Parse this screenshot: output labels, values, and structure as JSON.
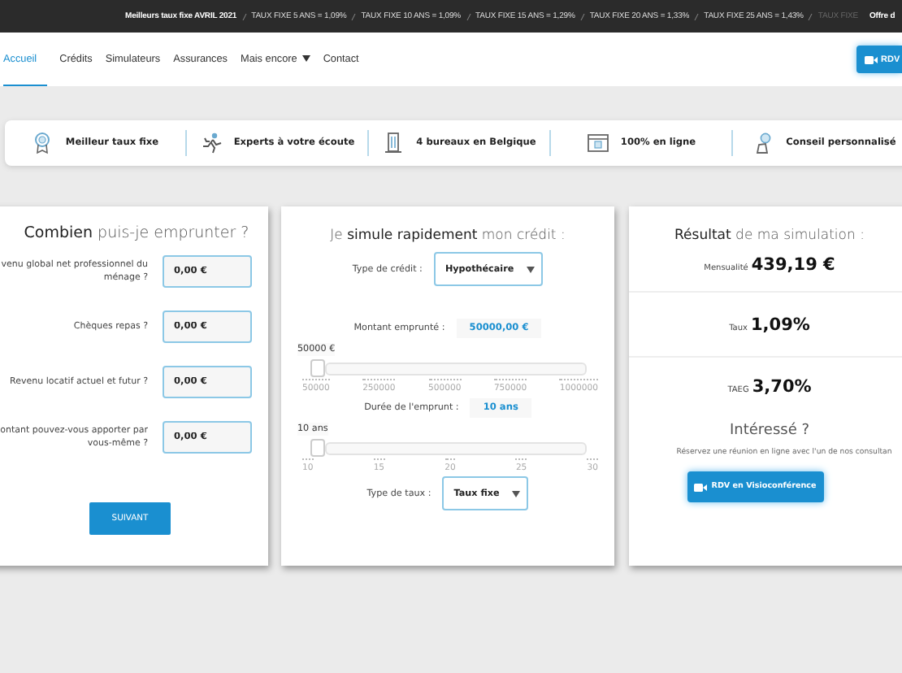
{
  "ticker": {
    "items": [
      {
        "text": "Meilleurs taux fixe AVRIL 2021",
        "kind": "heading"
      },
      {
        "text": "TAUX FIXE 5 ANS = 1,09%",
        "kind": "rate"
      },
      {
        "text": "TAUX FIXE 10 ANS = 1,09%",
        "kind": "rate"
      },
      {
        "text": "TAUX FIXE 15 ANS = 1,29%",
        "kind": "rate"
      },
      {
        "text": "TAUX FIXE 20 ANS = 1,33%",
        "kind": "rate"
      },
      {
        "text": "TAUX FIXE 25 ANS = 1,43%",
        "kind": "rate"
      },
      {
        "text": "TAUX FIXE",
        "kind": "faded"
      },
      {
        "text": "Offre d",
        "kind": "offer"
      }
    ]
  },
  "nav": {
    "items": [
      {
        "label": "Accueil",
        "selected": true,
        "dropdown": false
      },
      {
        "label": "Crédits",
        "selected": false,
        "dropdown": false
      },
      {
        "label": "Simulateurs",
        "selected": false,
        "dropdown": false
      },
      {
        "label": "Assurances",
        "selected": false,
        "dropdown": false
      },
      {
        "label": "Mais encore",
        "selected": false,
        "dropdown": true
      },
      {
        "label": "Contact",
        "selected": false,
        "dropdown": false
      }
    ],
    "button": {
      "label": "RDV"
    }
  },
  "features": [
    {
      "label": "Meilleur taux fixe"
    },
    {
      "label": "Experts à votre écoute"
    },
    {
      "label": "4 bureaux en Belgique"
    },
    {
      "label": "100% en ligne"
    },
    {
      "label": "Conseil personnalisé"
    }
  ],
  "borrow_card": {
    "title": "**Combien** puis-je emprunter ?",
    "fields": [
      {
        "label": "venu global net professionnel du ménage ?",
        "value": "0,00 €"
      },
      {
        "label": "Chèques repas ?",
        "value": "0,00 €"
      },
      {
        "label": "Revenu locatif actuel et futur ?",
        "value": "0,00 €"
      },
      {
        "label": "ontant pouvez-vous apporter par vous-même ?",
        "value": "0,00 €"
      }
    ],
    "button": "SUIVANT"
  },
  "simulate_card": {
    "title": "Je **simule rapidement** mon crédit :",
    "credit_type": {
      "label": "Type de crédit :",
      "value": "Hypothécaire"
    },
    "sliders": [
      {
        "label": "Montant emprunté :",
        "value": "50000,00 €",
        "bubble": "50000 €",
        "level": 0,
        "ticks": [
          "50000",
          "250000",
          "500000",
          "750000",
          "1000000"
        ]
      },
      {
        "label": "Durée de l'emprunt :",
        "value": "10 ans",
        "bubble": "10 ans",
        "level": 0,
        "ticks": [
          "10",
          "15",
          "20",
          "25",
          "30"
        ]
      }
    ],
    "rate_type": {
      "label": "Type de taux :",
      "value": "Taux fixe"
    }
  },
  "result_card": {
    "title": "**Résultat** de ma simulation :",
    "results": [
      {
        "label": "Mensualité",
        "value": "439,19 €"
      },
      {
        "label": "Taux",
        "value": "1,09%"
      },
      {
        "label": "TAEG",
        "value": "3,70%"
      }
    ],
    "interest": "Intéressé ?",
    "note": "Réservez une réunion en ligne avec l'un de nos consultan",
    "button": "RDV en Visioconférence"
  }
}
